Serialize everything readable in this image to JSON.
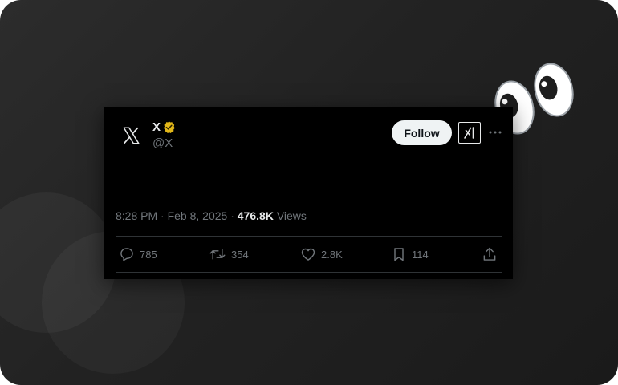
{
  "tweet": {
    "author": {
      "display_name": "X",
      "handle": "@X",
      "verified": true
    },
    "follow_label": "Follow",
    "timestamp": "8:28 PM · Feb 8, 2025",
    "separator": " · ",
    "views_count": "476.8K",
    "views_label": "Views",
    "actions": {
      "replies": "785",
      "reposts": "354",
      "likes": "2.8K",
      "bookmarks": "114"
    }
  },
  "colors": {
    "background": "#222222",
    "card": "#000000",
    "verified_badge": "#e2b719",
    "follow_button": "#eff3f4"
  },
  "icons": [
    "x-logo-icon",
    "verified-badge-icon",
    "grok-icon",
    "more-icon",
    "reply-icon",
    "repost-icon",
    "like-icon",
    "bookmark-icon",
    "share-icon",
    "eyes-emoji-icon"
  ]
}
